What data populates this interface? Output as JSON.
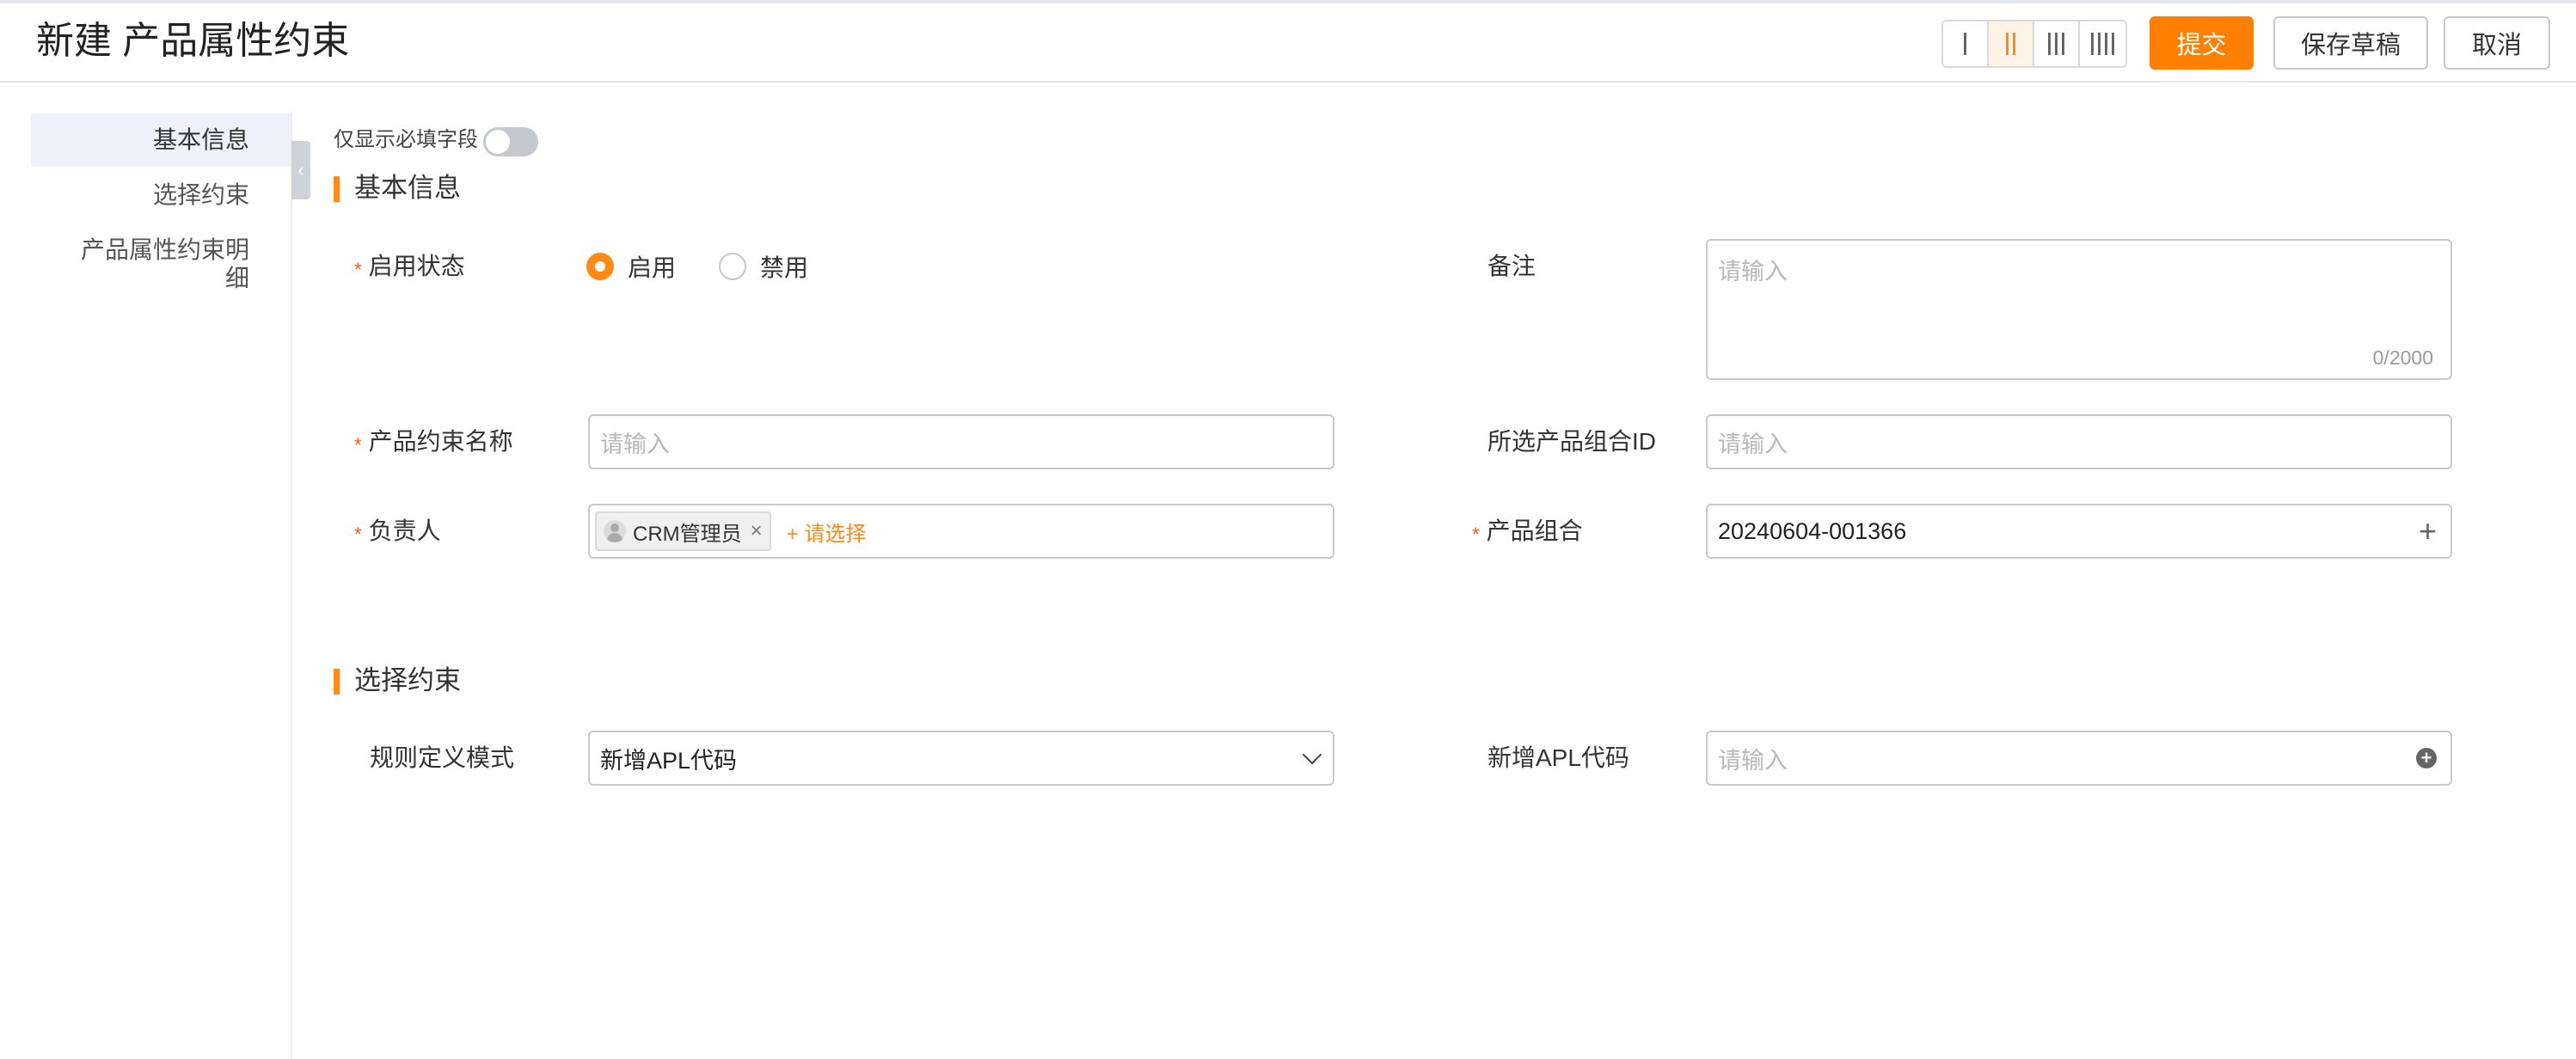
{
  "header": {
    "title": "新建 产品属性约束",
    "layout_options": [
      "1-column",
      "2-column",
      "3-column",
      "4-column"
    ],
    "active_layout": "2-column",
    "submit_label": "提交",
    "save_draft_label": "保存草稿",
    "cancel_label": "取消",
    "accent_color": "#ff8000"
  },
  "nav": {
    "items": [
      {
        "label": "基本信息",
        "active": true
      },
      {
        "label": "选择约束",
        "active": false
      },
      {
        "label": "产品属性约束明细",
        "active": false
      }
    ],
    "collapse_icon": "chevron-left-icon"
  },
  "filter": {
    "required_only_label": "仅显示必填字段",
    "required_only_on": false
  },
  "sections": {
    "basic": {
      "title": "基本信息",
      "status": {
        "label": "启用状态",
        "required": true,
        "options": [
          "启用",
          "禁用"
        ],
        "selected": "启用"
      },
      "remark": {
        "label": "备注",
        "placeholder": "请输入",
        "counter": "0/2000"
      },
      "name": {
        "label": "产品约束名称",
        "required": true,
        "placeholder": "请输入"
      },
      "combo_id": {
        "label": "所选产品组合ID",
        "placeholder": "请输入"
      },
      "owner": {
        "label": "负责人",
        "required": true,
        "tag": "CRM管理员",
        "add_label": "+ 请选择"
      },
      "combo": {
        "label": "产品组合",
        "required": true,
        "value": "20240604-001366"
      }
    },
    "constraint": {
      "title": "选择约束",
      "rule_mode": {
        "label": "规则定义模式",
        "value": "新增APL代码"
      },
      "apl_code": {
        "label": "新增APL代码",
        "placeholder": "请输入"
      }
    }
  }
}
